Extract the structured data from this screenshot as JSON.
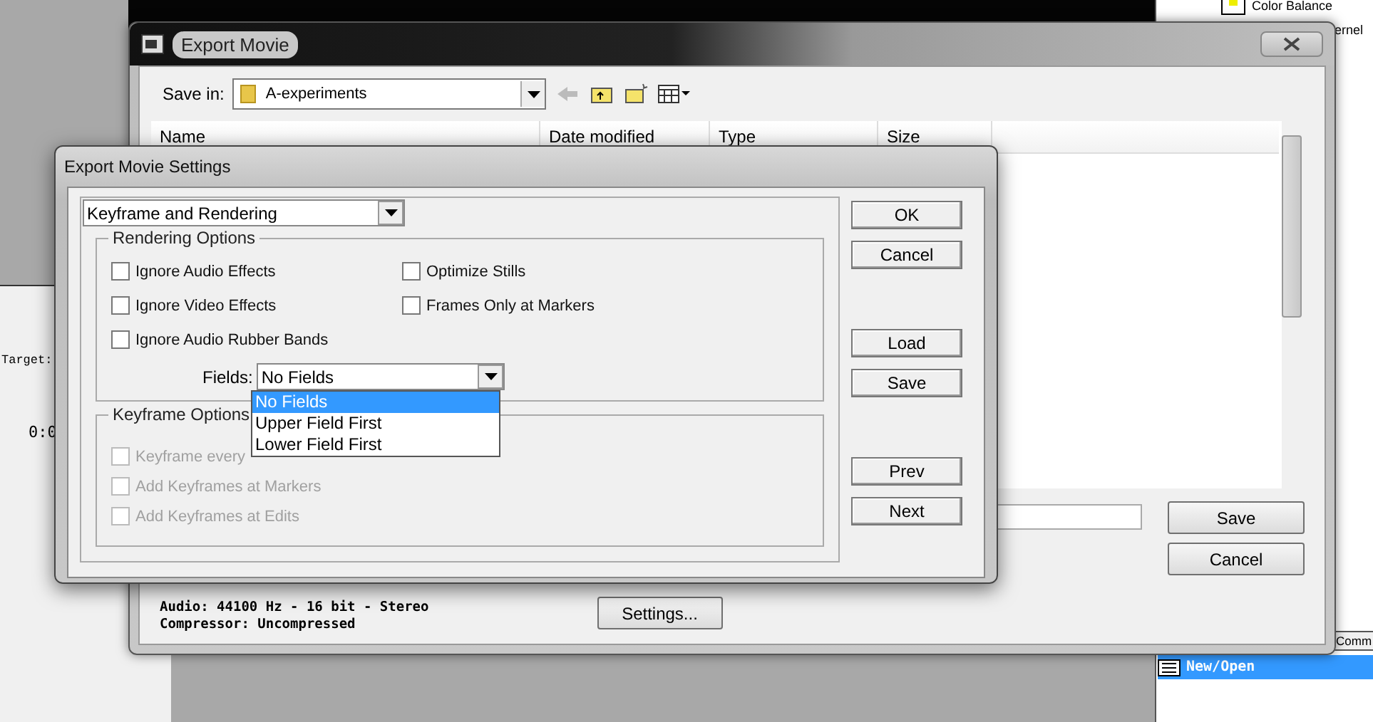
{
  "background_app": {
    "target_label": "Target:",
    "timecode": "0:0",
    "effects": [
      {
        "label": "Color Balance"
      },
      {
        "label": "ernel"
      }
    ],
    "tab_label": "Comm",
    "tree_item": {
      "label": "New/Open",
      "selected": true
    }
  },
  "export_movie": {
    "title": "Export Movie",
    "save_in": {
      "label": "Save in:",
      "value": "A-experiments"
    },
    "columns": [
      {
        "label": "Name"
      },
      {
        "label": "Date modified"
      },
      {
        "label": "Type"
      },
      {
        "label": "Size"
      }
    ],
    "info_lines": [
      "Audio: 44100 Hz - 16 bit - Stereo",
      "Compressor: Uncompressed"
    ],
    "settings_button": "Settings...",
    "buttons": [
      "Save",
      "Cancel"
    ]
  },
  "settings_dialog": {
    "title": "Export Movie Settings",
    "section_select": "Keyframe and Rendering",
    "rendering_options": {
      "title": "Rendering Options",
      "checkboxes": [
        {
          "label": "Ignore Audio Effects",
          "checked": false,
          "disabled": false
        },
        {
          "label": "Optimize Stills",
          "checked": false,
          "disabled": false
        },
        {
          "label": "Ignore Video Effects",
          "checked": false,
          "disabled": false
        },
        {
          "label": "Frames Only at Markers",
          "checked": false,
          "disabled": false
        },
        {
          "label": "Ignore Audio Rubber Bands",
          "checked": false,
          "disabled": false
        }
      ]
    },
    "fields": {
      "label": "Fields:",
      "value": "No Fields",
      "expanded": true,
      "options": [
        {
          "label": "No Fields",
          "selected": true
        },
        {
          "label": "Upper Field First",
          "selected": false
        },
        {
          "label": "Lower Field First",
          "selected": false
        }
      ]
    },
    "keyframe_options": {
      "title": "Keyframe Options",
      "checkboxes": [
        {
          "label": "Keyframe every",
          "checked": false,
          "disabled": true
        },
        {
          "label": "Add Keyframes at Markers",
          "checked": false,
          "disabled": true
        },
        {
          "label": "Add Keyframes at Edits",
          "checked": false,
          "disabled": true
        }
      ]
    },
    "button_groups": [
      [
        "OK",
        "Cancel"
      ],
      [
        "Load",
        "Save"
      ],
      [
        "Prev",
        "Next"
      ]
    ]
  }
}
